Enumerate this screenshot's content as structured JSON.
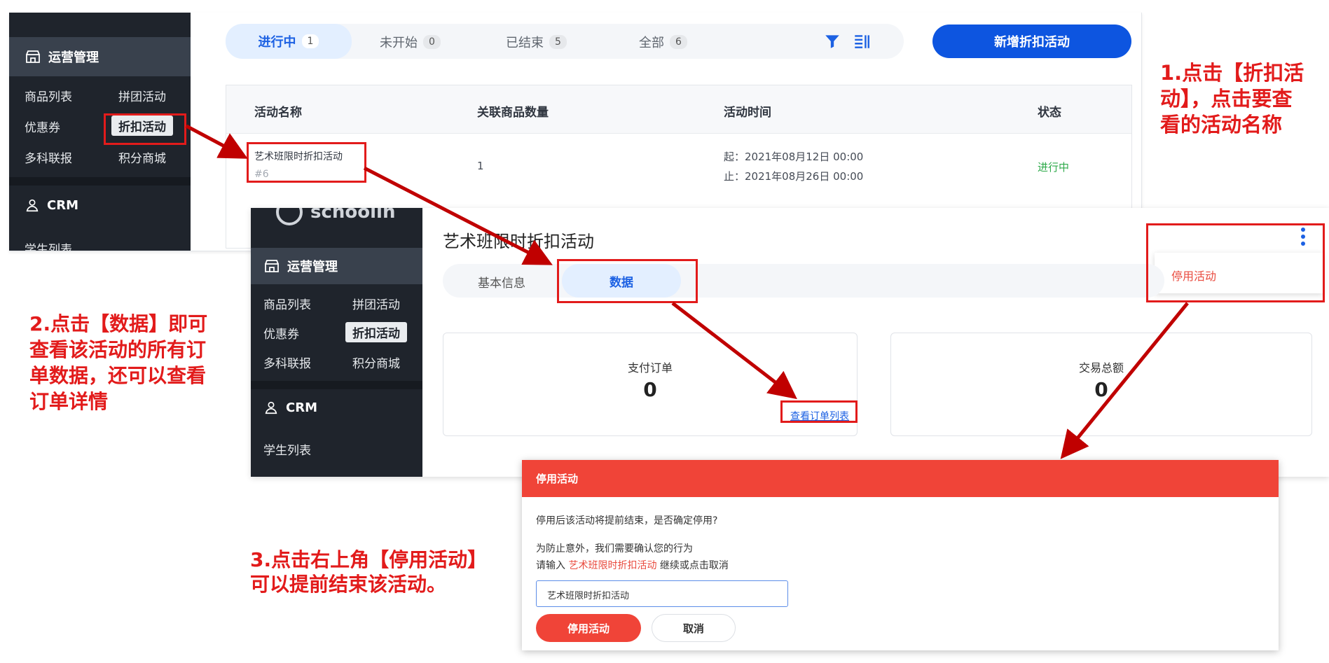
{
  "panel1": {
    "sidebar": {
      "group1_title": "运营管理",
      "items": [
        "商品列表",
        "拼团活动",
        "优惠券",
        "折扣活动",
        "多科联报",
        "积分商城"
      ],
      "group2_title": "CRM",
      "partial_item": "学生列表"
    },
    "tabs": [
      {
        "label": "进行中",
        "count": "1"
      },
      {
        "label": "未开始",
        "count": "0"
      },
      {
        "label": "已结束",
        "count": "5"
      },
      {
        "label": "全部",
        "count": "6"
      }
    ],
    "add_button": "新增折扣活动",
    "table": {
      "headers": [
        "活动名称",
        "关联商品数量",
        "活动时间",
        "状态"
      ],
      "row": {
        "name": "艺术班限时折扣活动",
        "id": "#6",
        "count": "1",
        "time_start": "起：2021年08月12日 00:00",
        "time_end": "止：2021年08月26日 00:00",
        "status": "进行中"
      }
    }
  },
  "panel2": {
    "logo_partial": "schoolin",
    "sidebar": {
      "group1_title": "运营管理",
      "items": [
        "商品列表",
        "拼团活动",
        "优惠券",
        "折扣活动",
        "多科联报",
        "积分商城"
      ],
      "group2_title": "CRM",
      "item_crm": "学生列表"
    },
    "page_title": "艺术班限时折扣活动",
    "tabs": [
      "基本信息",
      "数据"
    ],
    "more_menu_item": "停用活动",
    "cards": [
      {
        "label": "支付订单",
        "value": "0",
        "link": "查看订单列表"
      },
      {
        "label": "交易总额",
        "value": "0"
      }
    ]
  },
  "dialog": {
    "title": "停用活动",
    "message": "停用后该活动将提前结束，是否确定停用?",
    "line1": "为防止意外，我们需要确认您的行为",
    "line2_prefix": "请输入",
    "line2_highlight": "艺术班限时折扣活动",
    "line2_suffix": "继续或点击取消",
    "input_value": "艺术班限时折扣活动",
    "confirm_button": "停用活动",
    "cancel_button": "取消"
  },
  "annotations": {
    "step1_lines": [
      "1.点击【折扣活",
      "动】，点击要查",
      "看的活动名称"
    ],
    "step2_lines": [
      "2.点击【数据】即可",
      "查看该活动的所有订",
      "单数据，还可以查看",
      "订单详情"
    ],
    "step3_lines": [
      "3.点击右上角【停用活动】",
      "可以提前结束该活动。"
    ]
  },
  "colors": {
    "accent_blue": "#0d55e0",
    "annotation_red": "#e21b1b",
    "sidebar_dark": "#1f242c",
    "sidebar_group": "#39414d",
    "status_green": "#2eaa4a",
    "dialog_header": "#f04438"
  }
}
